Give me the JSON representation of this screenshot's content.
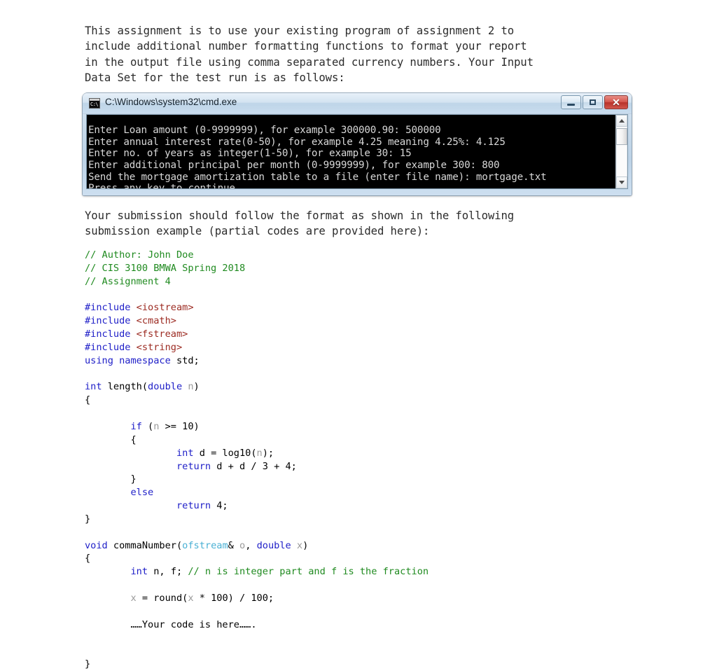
{
  "document": {
    "intro_paragraph": "This assignment is to use your existing program of assignment 2 to\ninclude additional number formatting functions to format your report\nin the output file using comma separated currency numbers. Your Input\nData Set for the test run is as follows:",
    "submission_paragraph": "Your submission should follow the format as shown in the following\nsubmission example (partial codes are provided here):"
  },
  "console_window": {
    "title": "C:\\Windows\\system32\\cmd.exe",
    "icon": "cmd-console-icon",
    "buttons": {
      "minimize": "Minimize",
      "maximize": "Maximize",
      "close": "Close",
      "close_glyph": "✕"
    },
    "output_lines": [
      "Enter Loan amount (0-9999999), for example 300000.90: 500000",
      "Enter annual interest rate(0-50), for example 4.25 meaning 4.25%: 4.125",
      "Enter no. of years as integer(1-50), for example 30: 15",
      "Enter additional principal per month (0-9999999), for example 300: 800",
      "Send the mortgage amortization table to a file (enter file name): mortgage.txt",
      "Press any key to continue . . ."
    ],
    "scrollbar": {
      "up_arrow": "▲",
      "down_arrow": "▼"
    },
    "colors": {
      "console_bg": "#000000",
      "console_fg": "#d8d8d8",
      "titlebar": "#c6d9ea",
      "close_button": "#b8322a"
    }
  },
  "code_listing": {
    "language": "cpp",
    "syntax_colors": {
      "comment": "#1f8a1f",
      "preprocessor": "#2020c8",
      "header_name": "#9c2b22",
      "keyword": "#2020c8",
      "type": "#49b0d4",
      "variable": "#9a9a9a",
      "plain": "#000000"
    },
    "lines": [
      [
        {
          "t": "// Author: John Doe",
          "c": "c-com"
        }
      ],
      [
        {
          "t": "// CIS 3100 BMWA Spring 2018",
          "c": "c-com"
        }
      ],
      [
        {
          "t": "// Assignment 4",
          "c": "c-com"
        }
      ],
      [
        {
          "t": "",
          "c": "c-txt"
        }
      ],
      [
        {
          "t": "#include",
          "c": "c-pre"
        },
        {
          "t": " ",
          "c": "c-txt"
        },
        {
          "t": "<iostream>",
          "c": "c-hdr"
        }
      ],
      [
        {
          "t": "#include",
          "c": "c-pre"
        },
        {
          "t": " ",
          "c": "c-txt"
        },
        {
          "t": "<cmath>",
          "c": "c-hdr"
        }
      ],
      [
        {
          "t": "#include",
          "c": "c-pre"
        },
        {
          "t": " ",
          "c": "c-txt"
        },
        {
          "t": "<fstream>",
          "c": "c-hdr"
        }
      ],
      [
        {
          "t": "#include",
          "c": "c-pre"
        },
        {
          "t": " ",
          "c": "c-txt"
        },
        {
          "t": "<string>",
          "c": "c-hdr"
        }
      ],
      [
        {
          "t": "using",
          "c": "c-kw"
        },
        {
          "t": " ",
          "c": "c-txt"
        },
        {
          "t": "namespace",
          "c": "c-kw"
        },
        {
          "t": " std;",
          "c": "c-txt"
        }
      ],
      [
        {
          "t": "",
          "c": "c-txt"
        }
      ],
      [
        {
          "t": "int",
          "c": "c-kw"
        },
        {
          "t": " length(",
          "c": "c-txt"
        },
        {
          "t": "double",
          "c": "c-kw"
        },
        {
          "t": " ",
          "c": "c-txt"
        },
        {
          "t": "n",
          "c": "c-var"
        },
        {
          "t": ")",
          "c": "c-txt"
        }
      ],
      [
        {
          "t": "{",
          "c": "c-txt"
        }
      ],
      [
        {
          "t": "",
          "c": "c-txt"
        }
      ],
      [
        {
          "t": "        ",
          "c": "c-txt"
        },
        {
          "t": "if",
          "c": "c-kw"
        },
        {
          "t": " (",
          "c": "c-txt"
        },
        {
          "t": "n",
          "c": "c-var"
        },
        {
          "t": " >= ",
          "c": "c-txt"
        },
        {
          "t": "10",
          "c": "c-txt"
        },
        {
          "t": ")",
          "c": "c-txt"
        }
      ],
      [
        {
          "t": "        {",
          "c": "c-txt"
        }
      ],
      [
        {
          "t": "                ",
          "c": "c-txt"
        },
        {
          "t": "int",
          "c": "c-kw"
        },
        {
          "t": " d = log10(",
          "c": "c-txt"
        },
        {
          "t": "n",
          "c": "c-var"
        },
        {
          "t": ");",
          "c": "c-txt"
        }
      ],
      [
        {
          "t": "                ",
          "c": "c-txt"
        },
        {
          "t": "return",
          "c": "c-kw"
        },
        {
          "t": " d + d / 3 + 4;",
          "c": "c-txt"
        }
      ],
      [
        {
          "t": "        }",
          "c": "c-txt"
        }
      ],
      [
        {
          "t": "        ",
          "c": "c-txt"
        },
        {
          "t": "else",
          "c": "c-kw"
        }
      ],
      [
        {
          "t": "                ",
          "c": "c-txt"
        },
        {
          "t": "return",
          "c": "c-kw"
        },
        {
          "t": " 4;",
          "c": "c-txt"
        }
      ],
      [
        {
          "t": "}",
          "c": "c-txt"
        }
      ],
      [
        {
          "t": "",
          "c": "c-txt"
        }
      ],
      [
        {
          "t": "void",
          "c": "c-kw"
        },
        {
          "t": " commaNumber(",
          "c": "c-txt"
        },
        {
          "t": "ofstream",
          "c": "c-type"
        },
        {
          "t": "& ",
          "c": "c-txt"
        },
        {
          "t": "o",
          "c": "c-var"
        },
        {
          "t": ", ",
          "c": "c-txt"
        },
        {
          "t": "double",
          "c": "c-kw"
        },
        {
          "t": " ",
          "c": "c-txt"
        },
        {
          "t": "x",
          "c": "c-var"
        },
        {
          "t": ")",
          "c": "c-txt"
        }
      ],
      [
        {
          "t": "{",
          "c": "c-txt"
        }
      ],
      [
        {
          "t": "        ",
          "c": "c-txt"
        },
        {
          "t": "int",
          "c": "c-kw"
        },
        {
          "t": " n, f; ",
          "c": "c-txt"
        },
        {
          "t": "// n is integer part and f is the fraction",
          "c": "c-com"
        }
      ],
      [
        {
          "t": "",
          "c": "c-txt"
        }
      ],
      [
        {
          "t": "        ",
          "c": "c-txt"
        },
        {
          "t": "x",
          "c": "c-var"
        },
        {
          "t": " = round(",
          "c": "c-txt"
        },
        {
          "t": "x",
          "c": "c-var"
        },
        {
          "t": " * 100) / 100;",
          "c": "c-txt"
        }
      ],
      [
        {
          "t": "",
          "c": "c-txt"
        }
      ],
      [
        {
          "t": "        ……Your code is here…….",
          "c": "c-txt"
        }
      ],
      [
        {
          "t": "",
          "c": "c-txt"
        }
      ],
      [
        {
          "t": "",
          "c": "c-txt"
        }
      ],
      [
        {
          "t": "}",
          "c": "c-txt"
        }
      ]
    ]
  }
}
